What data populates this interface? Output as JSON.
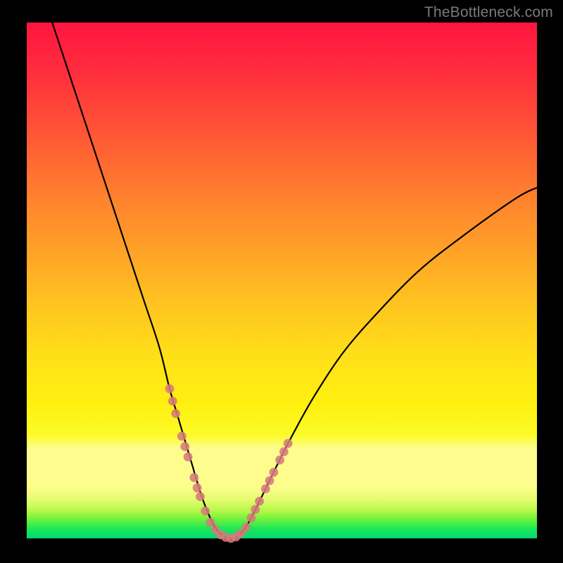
{
  "watermark": "TheBottleneck.com",
  "colors": {
    "background": "#000000",
    "curve": "#000000",
    "marker": "#d77a7b",
    "gradient_top": "#ff1540",
    "gradient_mid": "#fff010",
    "gradient_bottom": "#00d977"
  },
  "chart_data": {
    "type": "line",
    "title": "",
    "xlabel": "",
    "ylabel": "",
    "xlim": [
      0,
      100
    ],
    "ylim": [
      0,
      100
    ],
    "grid": false,
    "legend": false,
    "annotations": [
      "TheBottleneck.com"
    ],
    "series": [
      {
        "name": "bottleneck-curve",
        "x": [
          5,
          8,
          11,
          14,
          17,
          20,
          23,
          26,
          28,
          29.5,
          31,
          32.5,
          34,
          35.5,
          37,
          38.5,
          40,
          42,
          44,
          47,
          51,
          56,
          62,
          69,
          77,
          86,
          96,
          100
        ],
        "y": [
          100,
          91,
          82,
          73,
          64,
          55,
          46,
          37,
          29,
          24,
          19,
          14,
          9,
          5,
          2,
          0.5,
          0,
          1,
          4,
          10,
          18,
          27,
          36,
          44,
          52,
          59,
          66,
          68
        ]
      }
    ],
    "markers": {
      "name": "highlight-points",
      "x": [
        28.0,
        28.6,
        29.2,
        30.4,
        31.0,
        31.6,
        32.8,
        33.4,
        34.0,
        35.0,
        36.0,
        37.0,
        38.0,
        39.0,
        40.0,
        41.0,
        42.0,
        43.0,
        44.0,
        44.8,
        45.6,
        46.8,
        47.6,
        48.4,
        49.6,
        50.4,
        51.2
      ],
      "y": [
        29.0,
        26.6,
        24.2,
        19.8,
        17.8,
        15.8,
        11.8,
        9.8,
        8.1,
        5.3,
        3.1,
        1.7,
        0.7,
        0.2,
        0.0,
        0.3,
        1.0,
        2.2,
        4.0,
        5.6,
        7.2,
        9.6,
        11.2,
        12.8,
        15.2,
        16.8,
        18.4
      ]
    }
  }
}
